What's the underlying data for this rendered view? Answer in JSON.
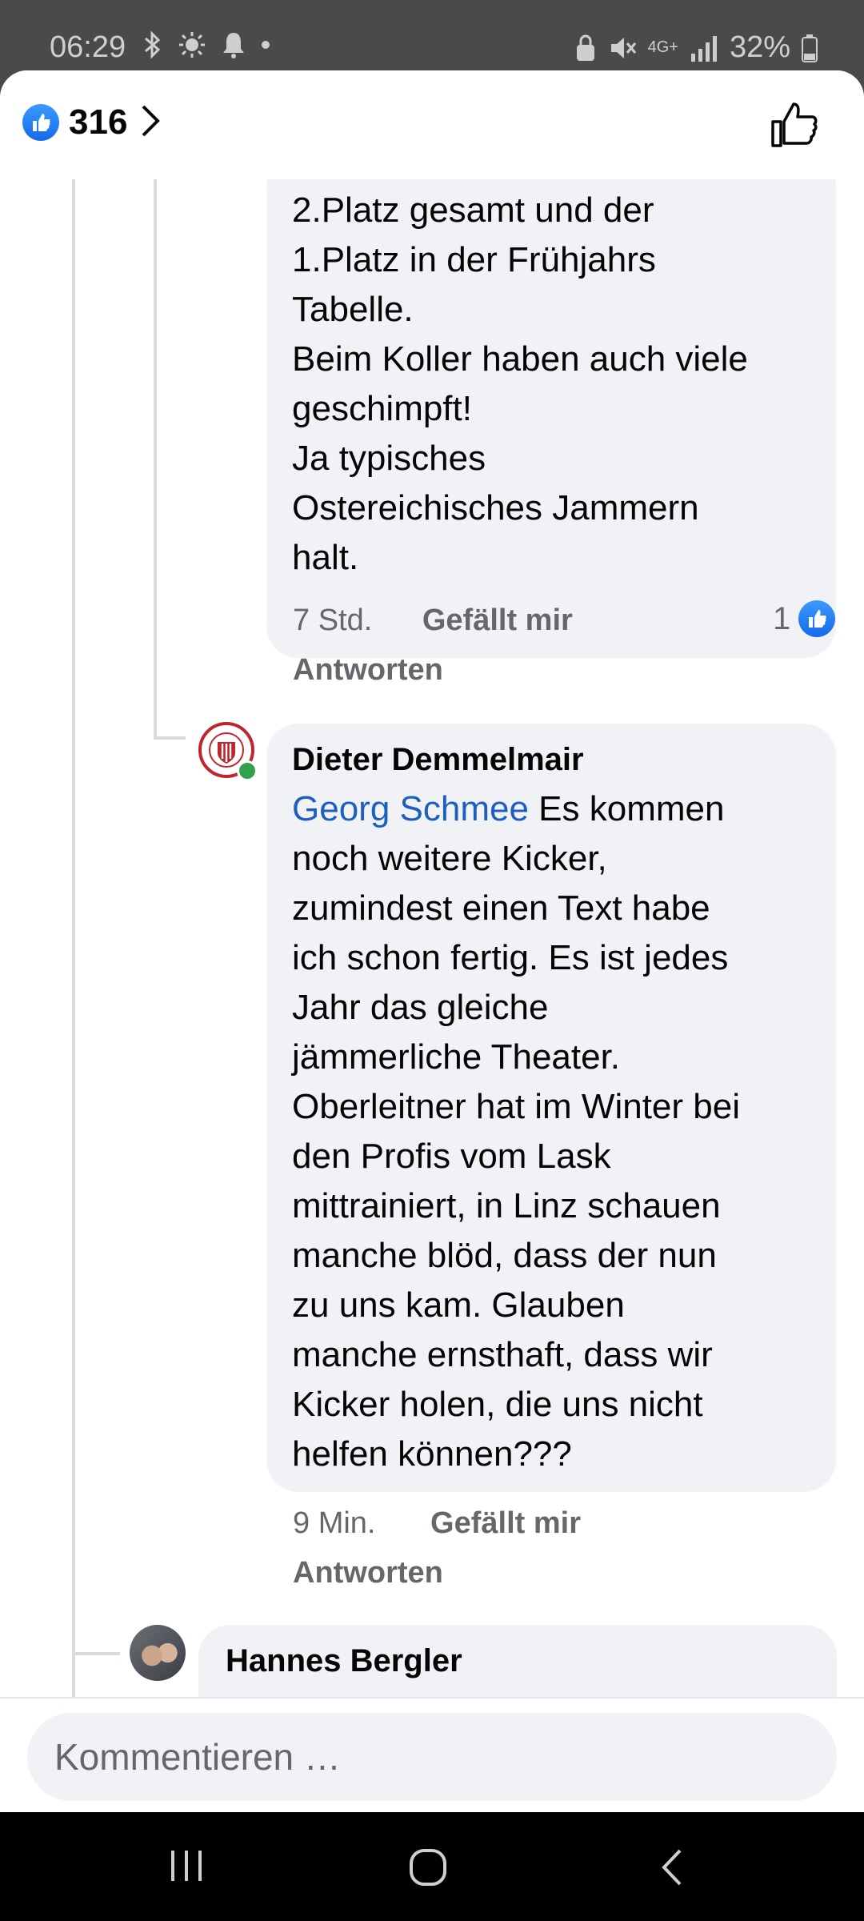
{
  "status_bar": {
    "time": "06:29",
    "network": "4G+",
    "battery": "32%"
  },
  "header": {
    "reaction_count": "316"
  },
  "comments": [
    {
      "lines": [
        "2.Platz gesamt und der",
        "1.Platz in der Frühjahrs",
        "Tabelle.",
        "Beim Koller haben auch viele",
        "geschimpft!",
        "Ja typisches",
        "Ostereichisches Jammern",
        "halt."
      ],
      "time": "7 Std.",
      "like_label": "Gefällt mir",
      "reply_label": "Antworten",
      "reaction_count": "1"
    },
    {
      "author": "Dieter Demmelmair",
      "mention": "Georg Schmee",
      "first_line_rest": " Es kommen",
      "lines": [
        "noch weitere Kicker,",
        "zumindest einen Text habe",
        "ich schon fertig. Es ist jedes",
        "Jahr das gleiche",
        "jämmerliche Theater.",
        "Oberleitner hat im Winter bei",
        "den Profis vom Lask",
        "mittrainiert, in Linz schauen",
        "manche blöd, dass der nun",
        "zu uns kam. Glauben",
        "manche ernsthaft, dass wir",
        "Kicker holen, die uns nicht",
        "helfen können???"
      ],
      "time": "9 Min.",
      "like_label": "Gefällt mir",
      "reply_label": "Antworten"
    },
    {
      "author": "Hannes Bergler"
    }
  ],
  "composer": {
    "placeholder": "Kommentieren …"
  },
  "colors": {
    "link": "#1d5fbf",
    "like_blue": "#1877f2",
    "bubble_bg": "#f0f2f5",
    "meta_text": "#65676b"
  },
  "icons": [
    "bluetooth-icon",
    "brightness-icon",
    "bell-icon",
    "lock-icon",
    "mute-icon",
    "signal-icon",
    "battery-icon",
    "like-icon",
    "chevron-right-icon",
    "thumbs-up-outline-icon",
    "recents-icon",
    "home-icon",
    "back-icon"
  ]
}
